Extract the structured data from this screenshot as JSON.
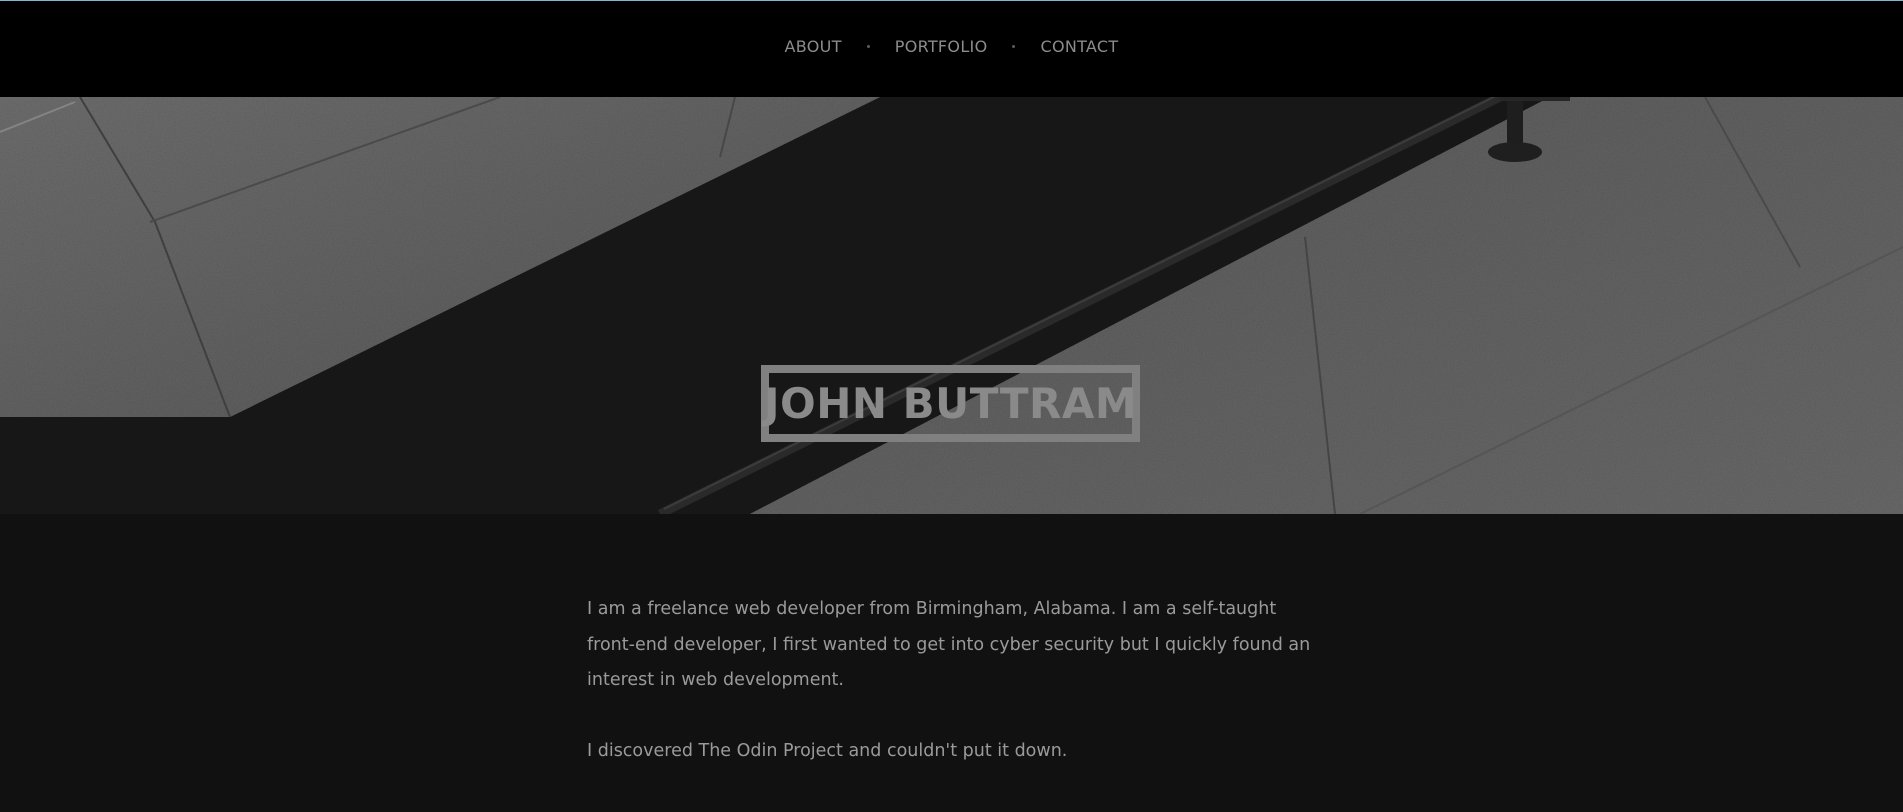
{
  "nav": {
    "items": [
      {
        "label": "ABOUT"
      },
      {
        "label": "PORTFOLIO"
      },
      {
        "label": "CONTACT"
      }
    ]
  },
  "hero": {
    "title": "JOHN BUTTRAM"
  },
  "about": {
    "paragraphs": [
      "I am a freelance web developer from Birmingham, Alabama. I am a self-taught front-end developer, I first wanted to get into cyber security but I quickly found an interest in web development.",
      "I discovered The Odin Project and couldn't put it down."
    ]
  },
  "colors": {
    "nav_background": "#000000",
    "page_background": "#111111",
    "text": "#9a9a9a",
    "title_border": "#808080"
  }
}
